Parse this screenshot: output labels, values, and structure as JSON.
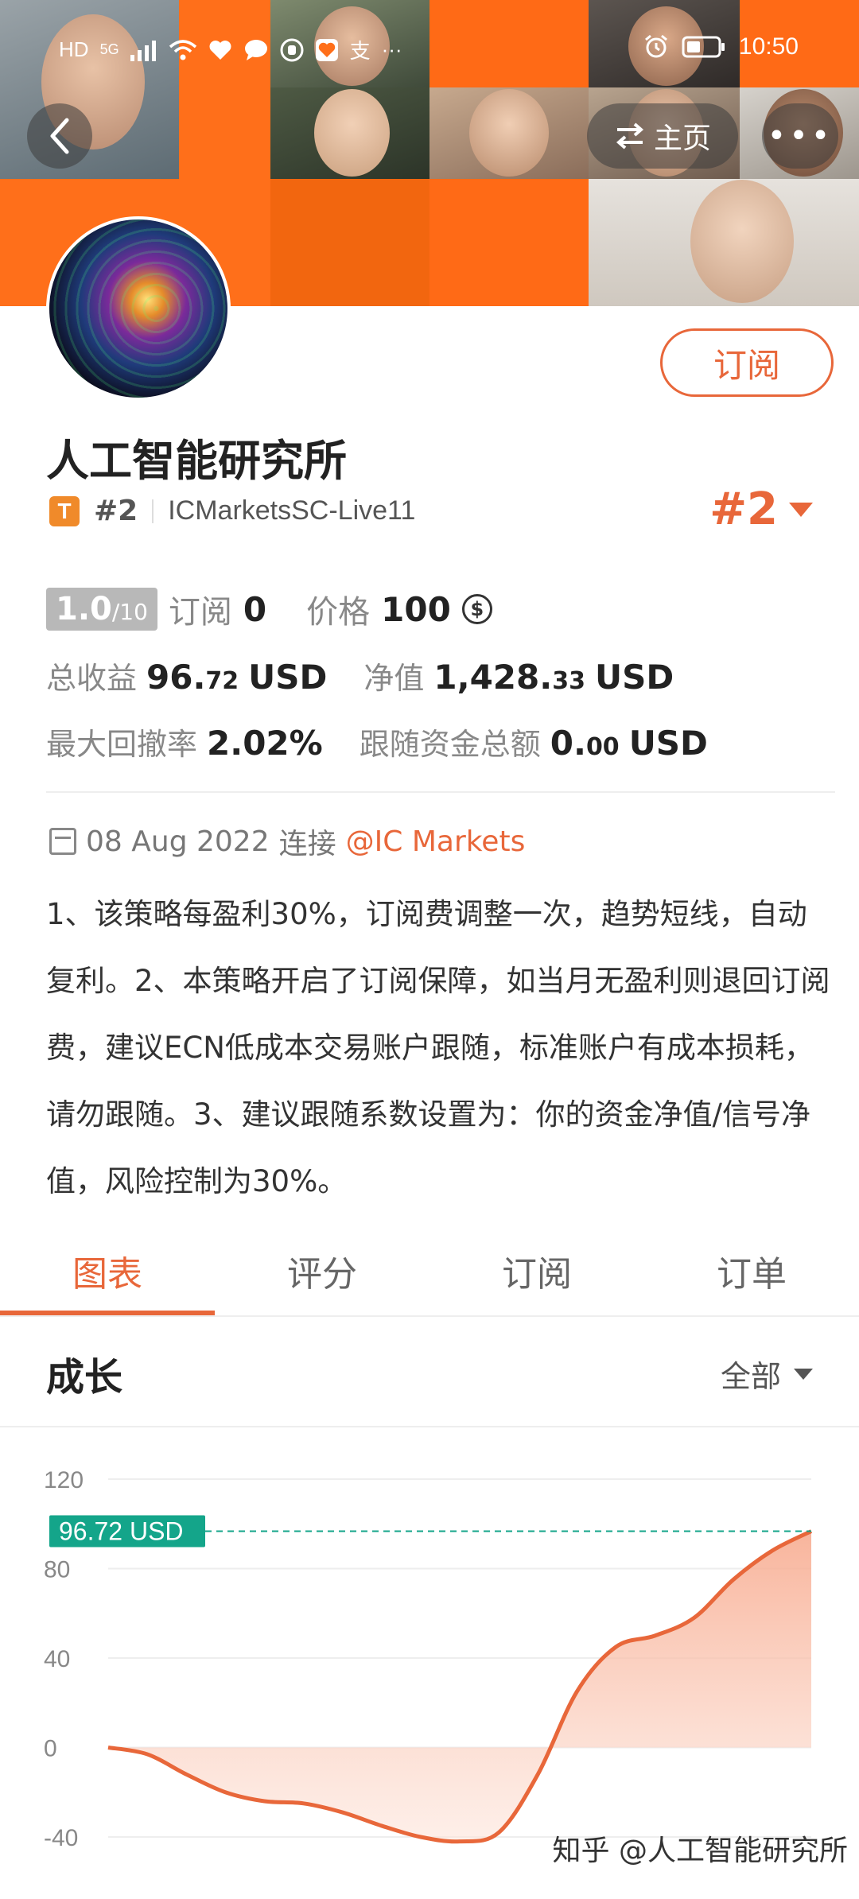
{
  "status_bar": {
    "left_icons": [
      "HD",
      "5G",
      "signal-icon",
      "wifi-icon",
      "heart-icon",
      "chat-icon",
      "hand-icon",
      "health-icon",
      "支",
      "···"
    ],
    "time": "10:50"
  },
  "nav": {
    "home_label": "主页"
  },
  "profile": {
    "subscribe_label": "订阅",
    "title": "人工智能研究所",
    "badge": "T",
    "rank_small": "#2",
    "server": "ICMarketsSC-Live11",
    "rank_big": "#2"
  },
  "stats": {
    "score_main": "1.0",
    "score_sub": "/10",
    "subs_label": "订阅",
    "subs_value": "0",
    "price_label": "价格",
    "price_value": "100",
    "coin_symbol": "$",
    "total_label": "总收益",
    "total_int": "96.",
    "total_dec": "72",
    "total_unit": "USD",
    "equity_label": "净值",
    "equity_int": "1,428.",
    "equity_dec": "33",
    "equity_unit": "USD",
    "dd_label": "最大回撤率",
    "dd_value": "2.02%",
    "follow_label": "跟随资金总额",
    "follow_int": "0.",
    "follow_dec": "00",
    "follow_unit": "USD"
  },
  "info": {
    "date": "08 Aug 2022",
    "connect_label": "连接",
    "broker": "@IC Markets",
    "description": "1、该策略每盈利30%，订阅费调整一次，趋势短线，自动复利。2、本策略开启了订阅保障，如当月无盈利则退回订阅费，建议ECN低成本交易账户跟随，标准账户有成本损耗，请勿跟随。3、建议跟随系数设置为：你的资金净值/信号净值，风险控制为30%。"
  },
  "tabs": [
    "图表",
    "评分",
    "订阅",
    "订单"
  ],
  "section": {
    "title": "成长",
    "range": "全部"
  },
  "chart_data": {
    "type": "area",
    "title": "",
    "xlabel": "",
    "ylabel": "",
    "ylim": [
      -40,
      120
    ],
    "yticks": [
      "120",
      "80",
      "40",
      "0",
      "-40"
    ],
    "x": [
      0,
      1,
      2,
      3,
      4,
      5,
      6,
      7,
      8,
      9,
      10,
      11,
      12,
      13,
      14,
      15,
      16,
      17,
      18
    ],
    "values": [
      0,
      -3,
      -12,
      -20,
      -24,
      -25,
      -29,
      -35,
      -40,
      -42,
      -38,
      -12,
      25,
      45,
      50,
      58,
      75,
      88,
      96.72
    ],
    "current_label": "96.72 USD",
    "colors": {
      "line": "#e8673a",
      "fill": "#f9c3ad",
      "badge": "#14a58a"
    }
  },
  "watermark": "知乎 @人工智能研究所"
}
